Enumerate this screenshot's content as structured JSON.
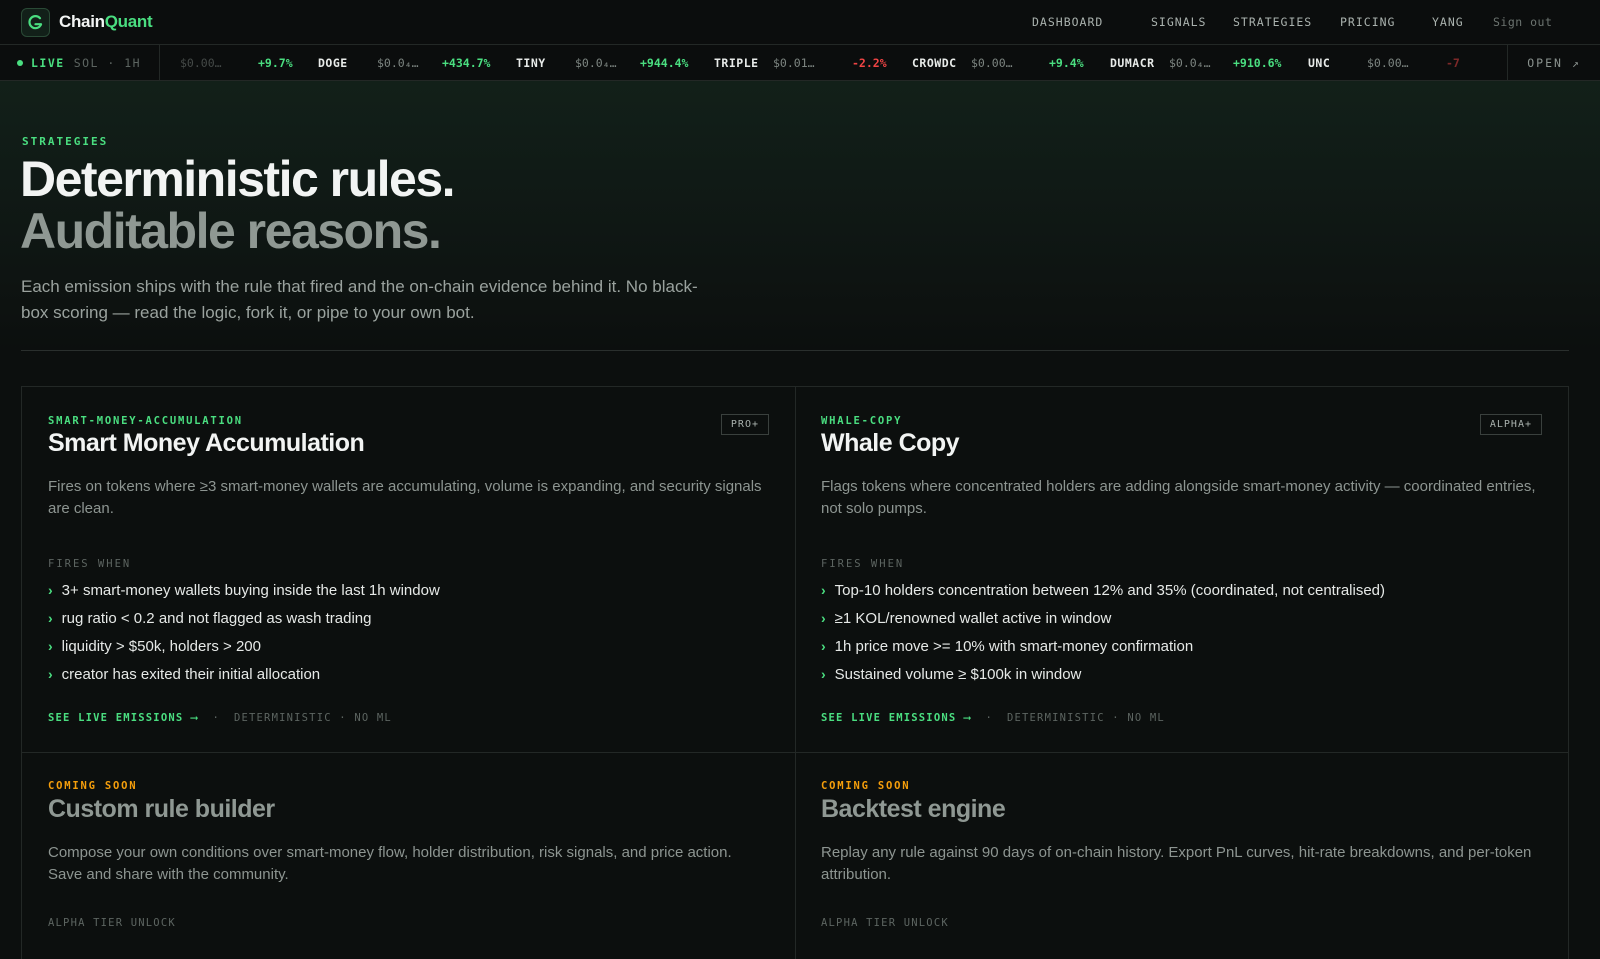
{
  "app": {
    "name_part1": "Chain",
    "name_part2": "Quant",
    "logo_letter": "G"
  },
  "nav": {
    "links": [
      "DASHBOARD",
      "SIGNALS",
      "STRATEGIES",
      "PRICING"
    ],
    "user": "YANG",
    "signout": "Sign out"
  },
  "ticker": {
    "live_label": "LIVE",
    "meta": "SOL · 1H",
    "open_label": "OPEN ↗",
    "items": [
      {
        "symbol": "",
        "price": "$0.00…",
        "change": "+9.7%",
        "dir": "up"
      },
      {
        "symbol": "DOGE",
        "price": "$0.0₄…",
        "change": "+434.7%",
        "dir": "up"
      },
      {
        "symbol": "TINY",
        "price": "$0.0₄…",
        "change": "+944.4%",
        "dir": "up"
      },
      {
        "symbol": "TRIPLE",
        "price": "$0.01…",
        "change": "-2.2%",
        "dir": "down"
      },
      {
        "symbol": "CROWDC",
        "price": "$0.00…",
        "change": "+9.4%",
        "dir": "up"
      },
      {
        "symbol": "DUMACR",
        "price": "$0.0₄…",
        "change": "+910.6%",
        "dir": "up"
      },
      {
        "symbol": "UNC",
        "price": "$0.00…",
        "change": "-7",
        "dir": "down"
      }
    ]
  },
  "hero": {
    "eyebrow": "STRATEGIES",
    "headline_line1": "Deterministic rules.",
    "headline_line2": "Auditable reasons.",
    "lede": "Each emission ships with the rule that fired and the on-chain evidence behind it. No black-box scoring — read the logic, fork it, or pipe to your own bot."
  },
  "strategies": [
    {
      "id": "SMART-MONEY-ACCUMULATION",
      "tier": "PRO+",
      "title": "Smart Money Accumulation",
      "description": "Fires on tokens where ≥3 smart-money wallets are accumulating, volume is expanding, and security signals are clean.",
      "fires_label": "FIRES WHEN",
      "rules": [
        "3+ smart-money wallets buying inside the last 1h window",
        "rug ratio < 0.2 and not flagged as wash trading",
        "liquidity > $50k, holders > 200",
        "creator has exited their initial allocation"
      ],
      "cta": "SEE LIVE EMISSIONS ⟶",
      "meta": "DETERMINISTIC · NO ML"
    },
    {
      "id": "WHALE-COPY",
      "tier": "ALPHA+",
      "title": "Whale Copy",
      "description": "Flags tokens where concentrated holders are adding alongside smart-money activity — coordinated entries, not solo pumps.",
      "fires_label": "FIRES WHEN",
      "rules": [
        "Top-10 holders concentration between 12% and 35% (coordinated, not centralised)",
        "≥1 KOL/renowned wallet active in window",
        "1h price move >= 10% with smart-money confirmation",
        "Sustained volume ≥ $100k in window"
      ],
      "cta": "SEE LIVE EMISSIONS ⟶",
      "meta": "DETERMINISTIC · NO ML"
    }
  ],
  "coming_soon": [
    {
      "label": "COMING SOON",
      "title": "Custom rule builder",
      "description": "Compose your own conditions over smart-money flow, holder distribution, risk signals, and price action. Save and share with the community.",
      "unlock": "ALPHA TIER UNLOCK"
    },
    {
      "label": "COMING SOON",
      "title": "Backtest engine",
      "description": "Replay any rule against 90 days of on-chain history. Export PnL curves, hit-rate breakdowns, and per-token attribution.",
      "unlock": "ALPHA TIER UNLOCK"
    }
  ],
  "colors": {
    "accent": "#4ade80",
    "warning": "#f59e0b",
    "negative": "#ef4444",
    "background": "#0c0f0e"
  }
}
